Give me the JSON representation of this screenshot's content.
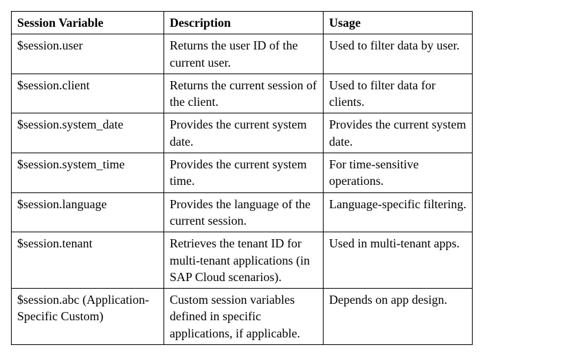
{
  "table": {
    "headers": {
      "variable": "Session Variable",
      "description": "Description",
      "usage": "Usage"
    },
    "rows": [
      {
        "variable": "$session.user",
        "description": "Returns the user ID of the current user.",
        "usage": "Used to filter data by user."
      },
      {
        "variable": "$session.client",
        "description": "Returns the current session of the client.",
        "usage": "Used to filter data for clients."
      },
      {
        "variable": "$session.system_date",
        "description": "Provides the current system date.",
        "usage": "Provides the current system date."
      },
      {
        "variable": "$session.system_time",
        "description": "Provides the current system time.",
        "usage": "For time-sensitive operations."
      },
      {
        "variable": "$session.language",
        "description": "Provides the language of the current session.",
        "usage": "Language-specific filtering."
      },
      {
        "variable": "$session.tenant",
        "description": "Retrieves the tenant ID for multi-tenant applications (in SAP Cloud scenarios).",
        "usage": "Used in multi-tenant apps."
      },
      {
        "variable": "$session.abc (Application-Specific Custom)",
        "description": "Custom session variables defined in specific applications, if applicable.",
        "usage": "Depends on app design."
      }
    ]
  }
}
